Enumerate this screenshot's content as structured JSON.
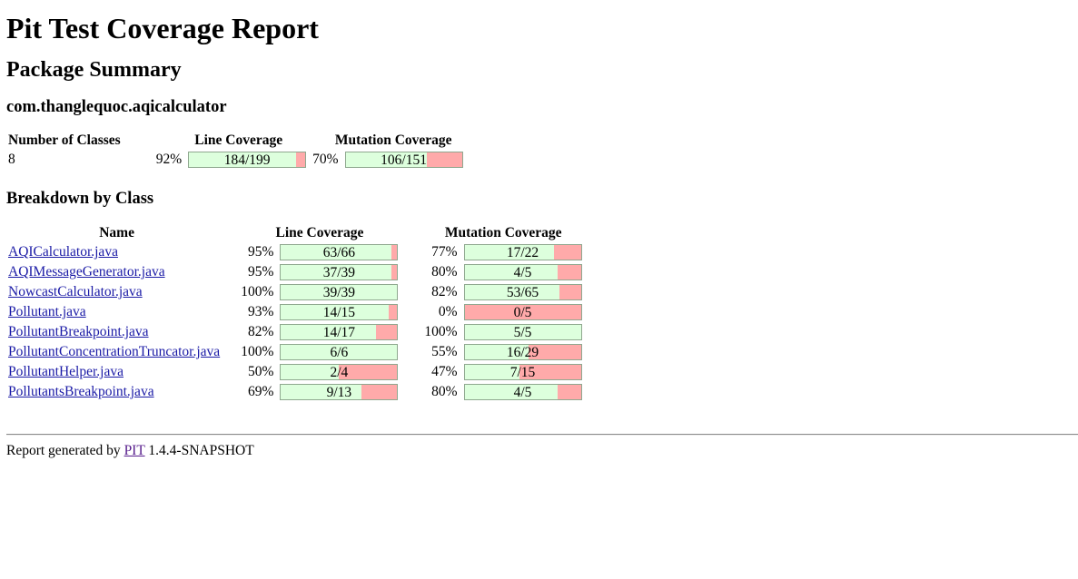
{
  "title": "Pit Test Coverage Report",
  "package_summary_heading": "Package Summary",
  "package_name": "com.thanglequoc.aqicalculator",
  "summary": {
    "headers": [
      "Number of Classes",
      "Line Coverage",
      "Mutation Coverage"
    ],
    "num_classes": "8",
    "line": {
      "pct": "92%",
      "label": "184/199",
      "fraction": 0.92
    },
    "mutation": {
      "pct": "70%",
      "label": "106/151",
      "fraction": 0.7
    }
  },
  "breakdown_heading": "Breakdown by Class",
  "breakdown_headers": [
    "Name",
    "Line Coverage",
    "Mutation Coverage"
  ],
  "classes": [
    {
      "name": "AQICalculator.java",
      "line_pct": "95%",
      "line_label": "63/66",
      "line_fraction": 0.95,
      "mut_pct": "77%",
      "mut_label": "17/22",
      "mut_fraction": 0.77
    },
    {
      "name": "AQIMessageGenerator.java",
      "line_pct": "95%",
      "line_label": "37/39",
      "line_fraction": 0.95,
      "mut_pct": "80%",
      "mut_label": "4/5",
      "mut_fraction": 0.8
    },
    {
      "name": "NowcastCalculator.java",
      "line_pct": "100%",
      "line_label": "39/39",
      "line_fraction": 1.0,
      "mut_pct": "82%",
      "mut_label": "53/65",
      "mut_fraction": 0.82
    },
    {
      "name": "Pollutant.java",
      "line_pct": "93%",
      "line_label": "14/15",
      "line_fraction": 0.93,
      "mut_pct": "0%",
      "mut_label": "0/5",
      "mut_fraction": 0.0
    },
    {
      "name": "PollutantBreakpoint.java",
      "line_pct": "82%",
      "line_label": "14/17",
      "line_fraction": 0.82,
      "mut_pct": "100%",
      "mut_label": "5/5",
      "mut_fraction": 1.0
    },
    {
      "name": "PollutantConcentrationTruncator.java",
      "line_pct": "100%",
      "line_label": "6/6",
      "line_fraction": 1.0,
      "mut_pct": "55%",
      "mut_label": "16/29",
      "mut_fraction": 0.55
    },
    {
      "name": "PollutantHelper.java",
      "line_pct": "50%",
      "line_label": "2/4",
      "line_fraction": 0.5,
      "mut_pct": "47%",
      "mut_label": "7/15",
      "mut_fraction": 0.47
    },
    {
      "name": "PollutantsBreakpoint.java",
      "line_pct": "69%",
      "line_label": "9/13",
      "line_fraction": 0.69,
      "mut_pct": "80%",
      "mut_label": "4/5",
      "mut_fraction": 0.8
    }
  ],
  "footer": {
    "prefix": "Report generated by ",
    "link": "PIT",
    "suffix": " 1.4.4-SNAPSHOT"
  },
  "colors": {
    "covered": "#ddffdd",
    "uncovered": "#ffaaaa",
    "link": "#1a1aa6",
    "visited_link": "#551a8b"
  }
}
